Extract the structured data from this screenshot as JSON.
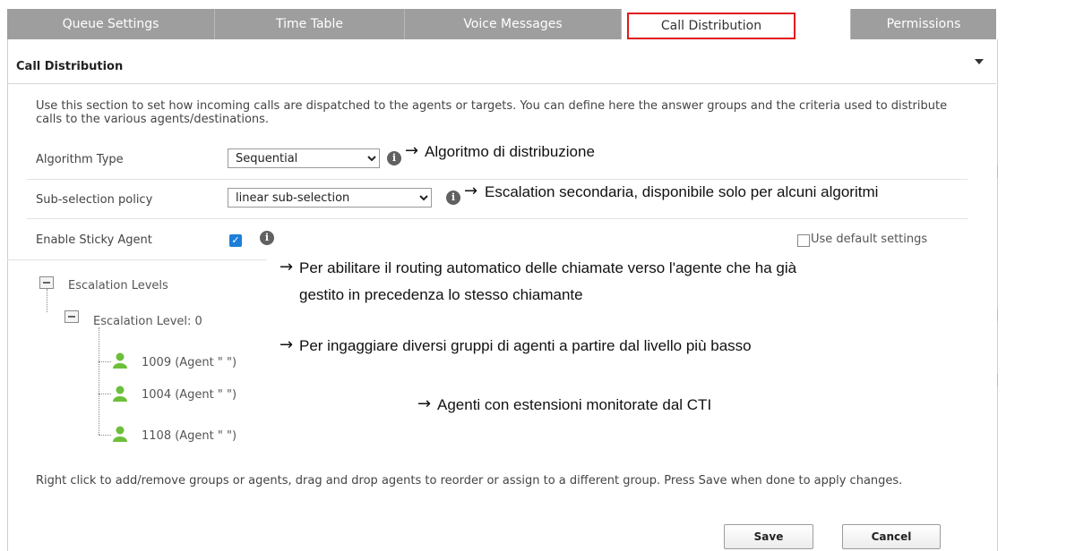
{
  "tabs": [
    {
      "label": "Queue Settings"
    },
    {
      "label": "Time Table"
    },
    {
      "label": "Voice Messages"
    },
    {
      "label": "Call Distribution"
    },
    {
      "label": "Permissions"
    }
  ],
  "section": {
    "title": "Call Distribution",
    "description": "Use this section to set how incoming calls are dispatched to the agents or targets. You can define here the answer groups and the criteria used to distribute calls to the various agents/destinations."
  },
  "form": {
    "algorithm_label": "Algorithm Type",
    "algorithm_value": "Sequential",
    "subselection_label": "Sub-selection policy",
    "subselection_value": "linear sub-selection",
    "sticky_label": "Enable Sticky Agent",
    "sticky_checked": true,
    "use_default_label": "Use default settings"
  },
  "tree": {
    "root": "Escalation Levels",
    "level": "Escalation Level: 0",
    "agents": [
      "1009 (Agent \" \")",
      "1004 (Agent \" \")",
      "1108 (Agent \" \")"
    ]
  },
  "footer": {
    "help": "Right click to add/remove groups or agents, drag and drop agents to reorder or assign to a different group. Press Save when done to apply changes.",
    "save_label": "Save",
    "cancel_label": "Cancel"
  },
  "annotations": {
    "algorithm": "Algoritmo di distribuzione",
    "subselection": "Escalation secondaria, disponibile solo per alcuni algoritmi",
    "sticky_line1": "Per abilitare il routing automatico delle chiamate verso l'agente che ha già",
    "sticky_line2": "gestito in precedenza lo stesso chiamante",
    "escalation": "Per ingaggiare diversi gruppi di agenti a partire dal livello più basso",
    "agents": "Agenti con estensioni monitorate dal CTI"
  },
  "icons": {
    "arrow": "→",
    "info": "i",
    "check": "✓"
  },
  "colors": {
    "tab_bg": "#9e9e9e",
    "active_tab_border": "#e0181e",
    "checkbox": "#1e7fd8",
    "agent_icon": "#6cbf3a"
  }
}
